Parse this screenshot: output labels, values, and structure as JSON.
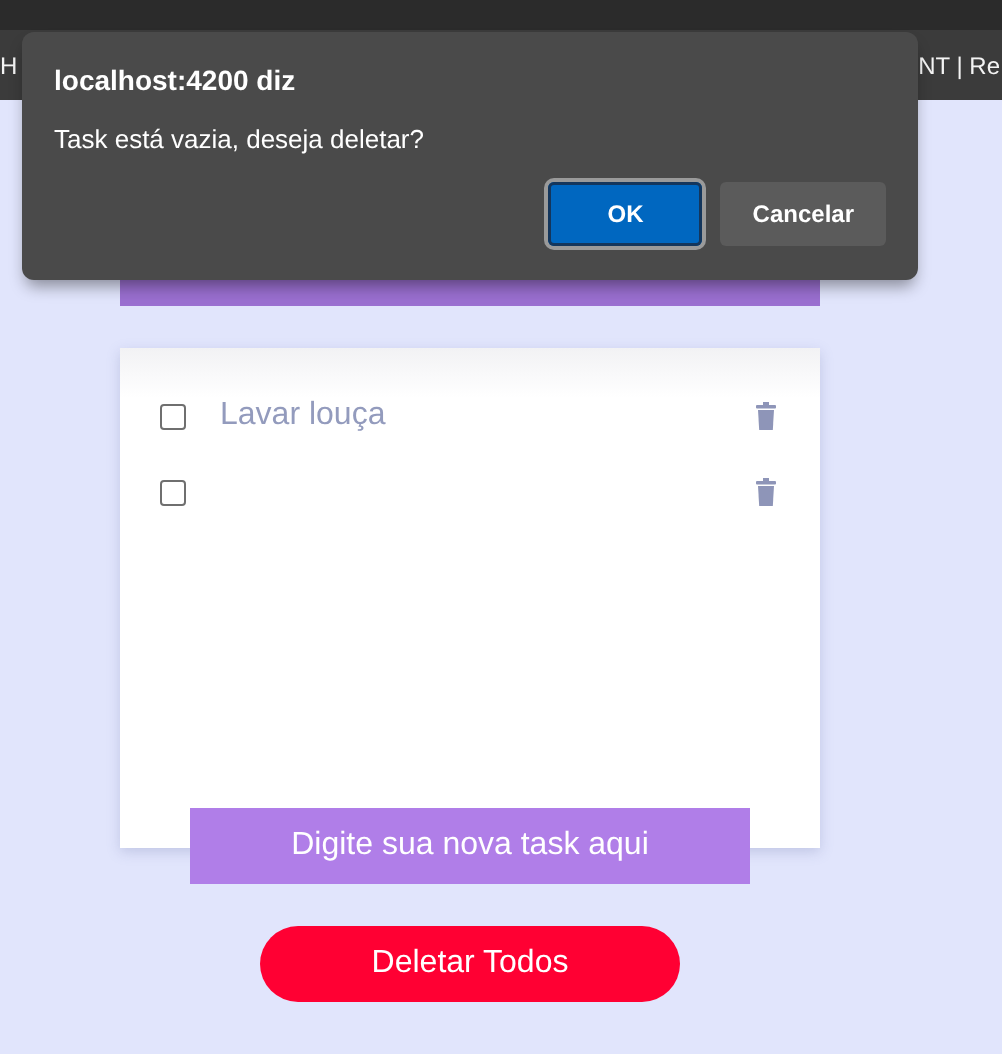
{
  "browser": {
    "bookmarks": [
      "H",
      "NT | Re"
    ]
  },
  "dialog": {
    "title": "localhost:4200 diz",
    "message": "Task está vazia, deseja deletar?",
    "buttons": [
      {
        "label": "OK",
        "kind": "primary"
      },
      {
        "label": "Cancelar",
        "kind": "secondary"
      }
    ]
  },
  "tasks": [
    {
      "text": "Lavar louça",
      "checked": false
    },
    {
      "checked": false
    }
  ],
  "new_task": {
    "placeholder": "Digite sua nova task aqui"
  },
  "delete_all_button": "Deletar Todos"
}
